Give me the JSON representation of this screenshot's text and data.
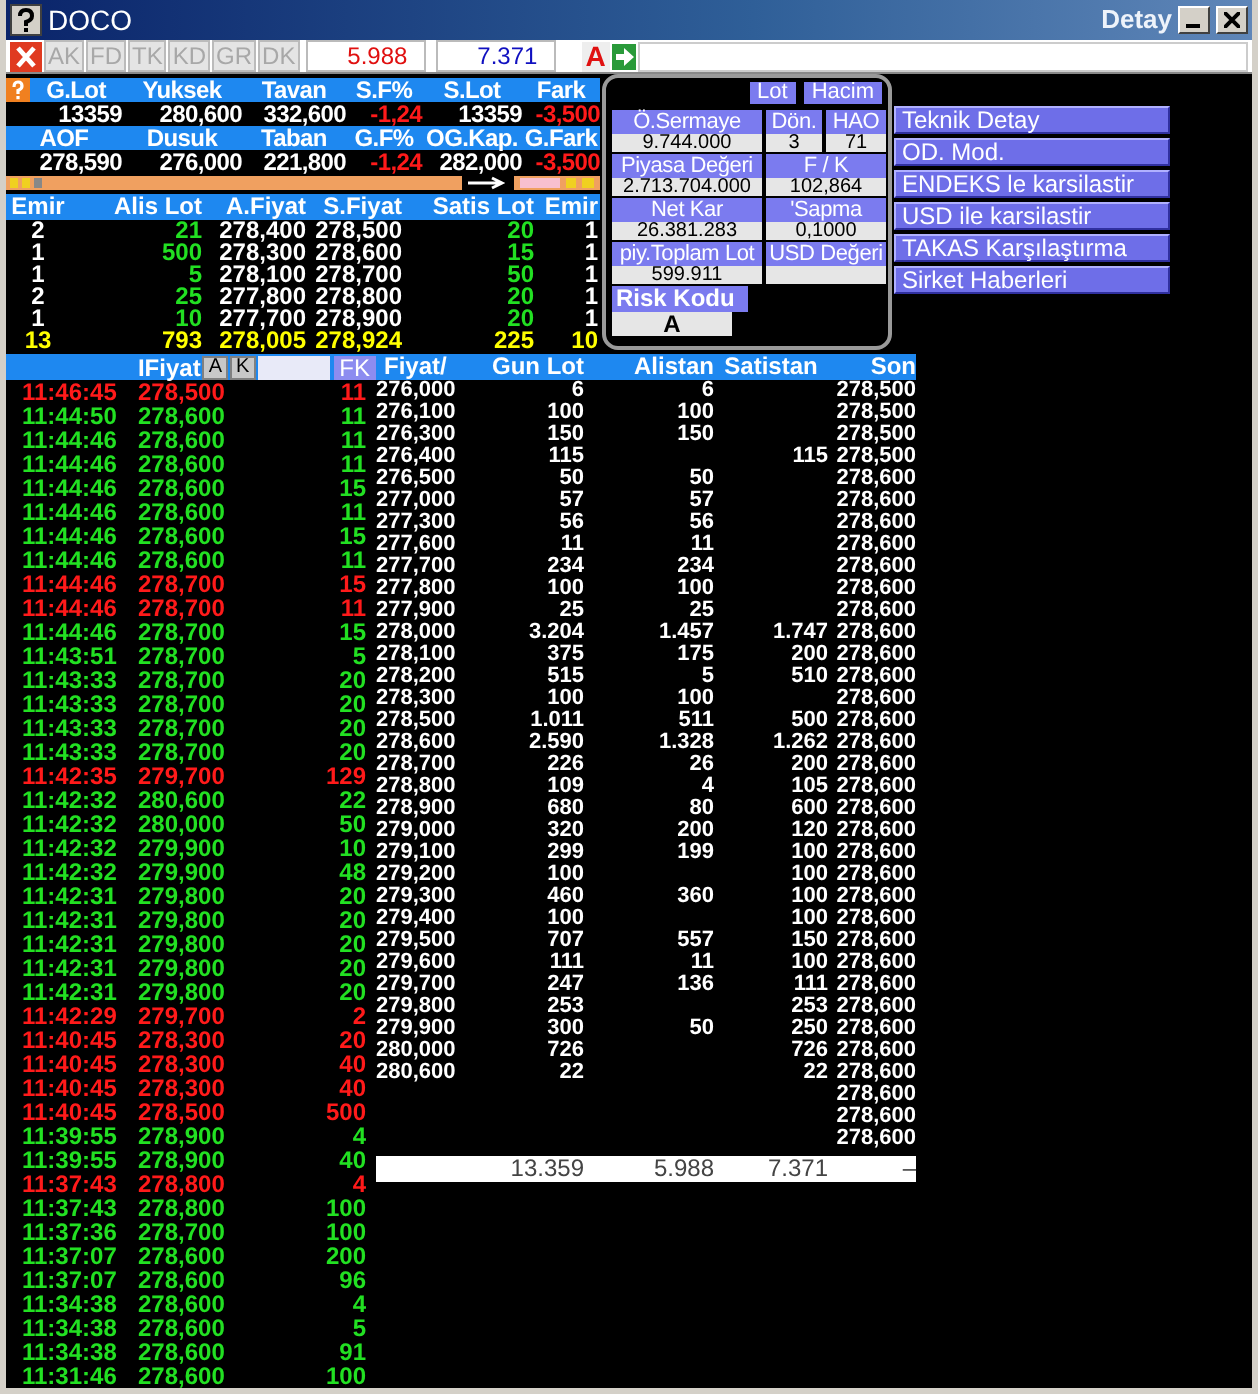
{
  "window": {
    "title": "DOCO",
    "subtitle": "Detay"
  },
  "toolbar": {
    "buttons": [
      {
        "label": "AK",
        "disabled": true
      },
      {
        "label": "FD",
        "disabled": true
      },
      {
        "label": "TK",
        "disabled": true
      },
      {
        "label": "KD",
        "disabled": true
      },
      {
        "label": "GR",
        "disabled": true
      },
      {
        "label": "DK",
        "disabled": true
      }
    ],
    "sell_total": "5.988",
    "buy_total": "7.371",
    "flag": "A"
  },
  "summary": [
    {
      "kind": "header",
      "cells": [
        {
          "text": "G.Lot"
        },
        {
          "text": "Yuksek"
        },
        {
          "text": "Tavan"
        },
        {
          "text": "S.F%"
        },
        {
          "text": "S.Lot"
        },
        {
          "text": "Fark"
        }
      ]
    },
    {
      "kind": "values",
      "cells": [
        {
          "text": "13359",
          "negative": false
        },
        {
          "text": "280,600",
          "negative": false
        },
        {
          "text": "332,600",
          "negative": false
        },
        {
          "text": "-1,24",
          "negative": true
        },
        {
          "text": "13359",
          "negative": false
        },
        {
          "text": "-3,500",
          "negative": true
        }
      ]
    },
    {
      "kind": "header",
      "cells": [
        {
          "text": "AOF"
        },
        {
          "text": "Dusuk"
        },
        {
          "text": "Taban"
        },
        {
          "text": "G.F%"
        },
        {
          "text": "OG.Kap."
        },
        {
          "text": "G.Fark"
        }
      ]
    },
    {
      "kind": "values",
      "cells": [
        {
          "text": "278,590",
          "negative": false
        },
        {
          "text": "276,000",
          "negative": false
        },
        {
          "text": "221,800",
          "negative": false
        },
        {
          "text": "-1,24",
          "negative": true
        },
        {
          "text": "282,000",
          "negative": false
        },
        {
          "text": "-3,500",
          "negative": true
        }
      ]
    }
  ],
  "depth": {
    "columns": [
      "Emir",
      "Alis Lot",
      "A.Fiyat",
      "S.Fiyat",
      "Satis Lot",
      "Emir"
    ],
    "rows": [
      [
        "2",
        "21",
        "278,400",
        "278,500",
        "20",
        "1"
      ],
      [
        "1",
        "500",
        "278,300",
        "278,600",
        "15",
        "1"
      ],
      [
        "1",
        "5",
        "278,100",
        "278,700",
        "50",
        "1"
      ],
      [
        "2",
        "25",
        "277,800",
        "278,800",
        "20",
        "1"
      ],
      [
        "1",
        "10",
        "277,700",
        "278,900",
        "20",
        "1"
      ]
    ],
    "total": [
      "13",
      "793",
      "278,005",
      "278,924",
      "225",
      "10"
    ]
  },
  "panel": {
    "toggles": [
      "Lot",
      "Hacim"
    ],
    "rows": [
      [
        {
          "label": "Ö.Sermaye",
          "value": "9.744.000"
        },
        {
          "label": "Dön.",
          "value": "3"
        },
        {
          "label": "HAO",
          "value": "71"
        }
      ],
      [
        {
          "label": "Piyasa Değeri",
          "value": "2.713.704.000"
        },
        {
          "label": "F / K",
          "value": "102,864"
        }
      ],
      [
        {
          "label": "Net Kar",
          "value": "26.381.283"
        },
        {
          "label": "'Sapma",
          "value": "0,1000"
        }
      ],
      [
        {
          "label": "piy.Toplam Lot",
          "value": "599.911"
        },
        {
          "label": "USD Değeri"
        }
      ]
    ],
    "risk": {
      "label": "Risk Kodu",
      "value": "A"
    }
  },
  "menu": [
    "Teknik Detay",
    "OD. Mod.",
    "ENDEKS le karsilastir",
    "USD ile karsilastir",
    "TAKAS Karşılaştırma",
    "Sirket Haberleri"
  ],
  "trades": {
    "header": "IFiyat",
    "buttons": [
      "A",
      "K"
    ],
    "filter": "FK",
    "rows": [
      {
        "time": "11:46:45",
        "price": "278,500",
        "lot": "11",
        "color": "#ff1a1a"
      },
      {
        "time": "11:44:50",
        "price": "278,600",
        "lot": "11",
        "color": "#22e022"
      },
      {
        "time": "11:44:46",
        "price": "278,600",
        "lot": "11",
        "color": "#22e022"
      },
      {
        "time": "11:44:46",
        "price": "278,600",
        "lot": "11",
        "color": "#22e022"
      },
      {
        "time": "11:44:46",
        "price": "278,600",
        "lot": "15",
        "color": "#22e022"
      },
      {
        "time": "11:44:46",
        "price": "278,600",
        "lot": "11",
        "color": "#22e022"
      },
      {
        "time": "11:44:46",
        "price": "278,600",
        "lot": "15",
        "color": "#22e022"
      },
      {
        "time": "11:44:46",
        "price": "278,600",
        "lot": "11",
        "color": "#22e022"
      },
      {
        "time": "11:44:46",
        "price": "278,700",
        "lot": "15",
        "color": "#ff1a1a"
      },
      {
        "time": "11:44:46",
        "price": "278,700",
        "lot": "11",
        "color": "#ff1a1a"
      },
      {
        "time": "11:44:46",
        "price": "278,700",
        "lot": "15",
        "color": "#22e022"
      },
      {
        "time": "11:43:51",
        "price": "278,700",
        "lot": "5",
        "color": "#22e022"
      },
      {
        "time": "11:43:33",
        "price": "278,700",
        "lot": "20",
        "color": "#22e022"
      },
      {
        "time": "11:43:33",
        "price": "278,700",
        "lot": "20",
        "color": "#22e022"
      },
      {
        "time": "11:43:33",
        "price": "278,700",
        "lot": "20",
        "color": "#22e022"
      },
      {
        "time": "11:43:33",
        "price": "278,700",
        "lot": "20",
        "color": "#22e022"
      },
      {
        "time": "11:42:35",
        "price": "279,700",
        "lot": "129",
        "color": "#ff1a1a"
      },
      {
        "time": "11:42:32",
        "price": "280,600",
        "lot": "22",
        "color": "#22e022"
      },
      {
        "time": "11:42:32",
        "price": "280,000",
        "lot": "50",
        "color": "#22e022"
      },
      {
        "time": "11:42:32",
        "price": "279,900",
        "lot": "10",
        "color": "#22e022"
      },
      {
        "time": "11:42:32",
        "price": "279,900",
        "lot": "48",
        "color": "#22e022"
      },
      {
        "time": "11:42:31",
        "price": "279,800",
        "lot": "20",
        "color": "#22e022"
      },
      {
        "time": "11:42:31",
        "price": "279,800",
        "lot": "20",
        "color": "#22e022"
      },
      {
        "time": "11:42:31",
        "price": "279,800",
        "lot": "20",
        "color": "#22e022"
      },
      {
        "time": "11:42:31",
        "price": "279,800",
        "lot": "20",
        "color": "#22e022"
      },
      {
        "time": "11:42:31",
        "price": "279,800",
        "lot": "20",
        "color": "#22e022"
      },
      {
        "time": "11:42:29",
        "price": "279,700",
        "lot": "2",
        "color": "#ff1a1a"
      },
      {
        "time": "11:40:45",
        "price": "278,300",
        "lot": "20",
        "color": "#ff1a1a"
      },
      {
        "time": "11:40:45",
        "price": "278,300",
        "lot": "40",
        "color": "#ff1a1a"
      },
      {
        "time": "11:40:45",
        "price": "278,300",
        "lot": "40",
        "color": "#ff1a1a"
      },
      {
        "time": "11:40:45",
        "price": "278,500",
        "lot": "500",
        "color": "#ff1a1a"
      },
      {
        "time": "11:39:55",
        "price": "278,900",
        "lot": "4",
        "color": "#22e022"
      },
      {
        "time": "11:39:55",
        "price": "278,900",
        "lot": "40",
        "color": "#22e022"
      },
      {
        "time": "11:37:43",
        "price": "278,800",
        "lot": "4",
        "color": "#ff1a1a"
      },
      {
        "time": "11:37:43",
        "price": "278,800",
        "lot": "100",
        "color": "#22e022"
      },
      {
        "time": "11:37:36",
        "price": "278,700",
        "lot": "100",
        "color": "#22e022"
      },
      {
        "time": "11:37:07",
        "price": "278,600",
        "lot": "200",
        "color": "#22e022"
      },
      {
        "time": "11:37:07",
        "price": "278,600",
        "lot": "96",
        "color": "#22e022"
      },
      {
        "time": "11:34:38",
        "price": "278,600",
        "lot": "4",
        "color": "#22e022"
      },
      {
        "time": "11:34:38",
        "price": "278,600",
        "lot": "5",
        "color": "#22e022"
      },
      {
        "time": "11:34:38",
        "price": "278,600",
        "lot": "91",
        "color": "#22e022"
      },
      {
        "time": "11:31:46",
        "price": "278,600",
        "lot": "100",
        "color": "#22e022"
      }
    ]
  },
  "levels": {
    "columns": [
      "Fiyat/",
      "Gun Lot",
      "Alistan",
      "Satistan",
      "Son"
    ],
    "rows": [
      {
        "fiyat": "276,000",
        "gun_lot": "6",
        "alistan": "6",
        "son": "278,500"
      },
      {
        "fiyat": "276,100",
        "gun_lot": "100",
        "alistan": "100",
        "son": "278,500"
      },
      {
        "fiyat": "276,300",
        "gun_lot": "150",
        "alistan": "150",
        "son": "278,500"
      },
      {
        "fiyat": "276,400",
        "gun_lot": "115",
        "satistan": "115",
        "son": "278,500"
      },
      {
        "fiyat": "276,500",
        "gun_lot": "50",
        "alistan": "50",
        "son": "278,600"
      },
      {
        "fiyat": "277,000",
        "gun_lot": "57",
        "alistan": "57",
        "son": "278,600"
      },
      {
        "fiyat": "277,300",
        "gun_lot": "56",
        "alistan": "56",
        "son": "278,600"
      },
      {
        "fiyat": "277,600",
        "gun_lot": "11",
        "alistan": "11",
        "son": "278,600"
      },
      {
        "fiyat": "277,700",
        "gun_lot": "234",
        "alistan": "234",
        "son": "278,600"
      },
      {
        "fiyat": "277,800",
        "gun_lot": "100",
        "alistan": "100",
        "son": "278,600"
      },
      {
        "fiyat": "277,900",
        "gun_lot": "25",
        "alistan": "25",
        "son": "278,600"
      },
      {
        "fiyat": "278,000",
        "gun_lot": "3.204",
        "alistan": "1.457",
        "satistan": "1.747",
        "son": "278,600"
      },
      {
        "fiyat": "278,100",
        "gun_lot": "375",
        "alistan": "175",
        "satistan": "200",
        "son": "278,600"
      },
      {
        "fiyat": "278,200",
        "gun_lot": "515",
        "alistan": "5",
        "satistan": "510",
        "son": "278,600"
      },
      {
        "fiyat": "278,300",
        "gun_lot": "100",
        "alistan": "100",
        "son": "278,600"
      },
      {
        "fiyat": "278,500",
        "gun_lot": "1.011",
        "alistan": "511",
        "satistan": "500",
        "son": "278,600"
      },
      {
        "fiyat": "278,600",
        "gun_lot": "2.590",
        "alistan": "1.328",
        "satistan": "1.262",
        "son": "278,600"
      },
      {
        "fiyat": "278,700",
        "gun_lot": "226",
        "alistan": "26",
        "satistan": "200",
        "son": "278,600"
      },
      {
        "fiyat": "278,800",
        "gun_lot": "109",
        "alistan": "4",
        "satistan": "105",
        "son": "278,600"
      },
      {
        "fiyat": "278,900",
        "gun_lot": "680",
        "alistan": "80",
        "satistan": "600",
        "son": "278,600"
      },
      {
        "fiyat": "279,000",
        "gun_lot": "320",
        "alistan": "200",
        "satistan": "120",
        "son": "278,600"
      },
      {
        "fiyat": "279,100",
        "gun_lot": "299",
        "alistan": "199",
        "satistan": "100",
        "son": "278,600"
      },
      {
        "fiyat": "279,200",
        "gun_lot": "100",
        "satistan": "100",
        "son": "278,600"
      },
      {
        "fiyat": "279,300",
        "gun_lot": "460",
        "alistan": "360",
        "satistan": "100",
        "son": "278,600"
      },
      {
        "fiyat": "279,400",
        "gun_lot": "100",
        "satistan": "100",
        "son": "278,600"
      },
      {
        "fiyat": "279,500",
        "gun_lot": "707",
        "alistan": "557",
        "satistan": "150",
        "son": "278,600"
      },
      {
        "fiyat": "279,600",
        "gun_lot": "111",
        "alistan": "11",
        "satistan": "100",
        "son": "278,600"
      },
      {
        "fiyat": "279,700",
        "gun_lot": "247",
        "alistan": "136",
        "satistan": "111",
        "son": "278,600"
      },
      {
        "fiyat": "279,800",
        "gun_lot": "253",
        "satistan": "253",
        "son": "278,600"
      },
      {
        "fiyat": "279,900",
        "gun_lot": "300",
        "alistan": "50",
        "satistan": "250",
        "son": "278,600"
      },
      {
        "fiyat": "280,000",
        "gun_lot": "726",
        "satistan": "726",
        "son": "278,600"
      },
      {
        "fiyat": "280,600",
        "gun_lot": "22",
        "satistan": "22",
        "son": "278,600"
      },
      {
        "son": "278,600"
      },
      {
        "son": "278,600"
      },
      {
        "son": "278,600"
      }
    ],
    "totals": {
      "gun_lot": "13.359",
      "alistan": "5.988",
      "satistan": "7.371",
      "son": "–"
    }
  }
}
